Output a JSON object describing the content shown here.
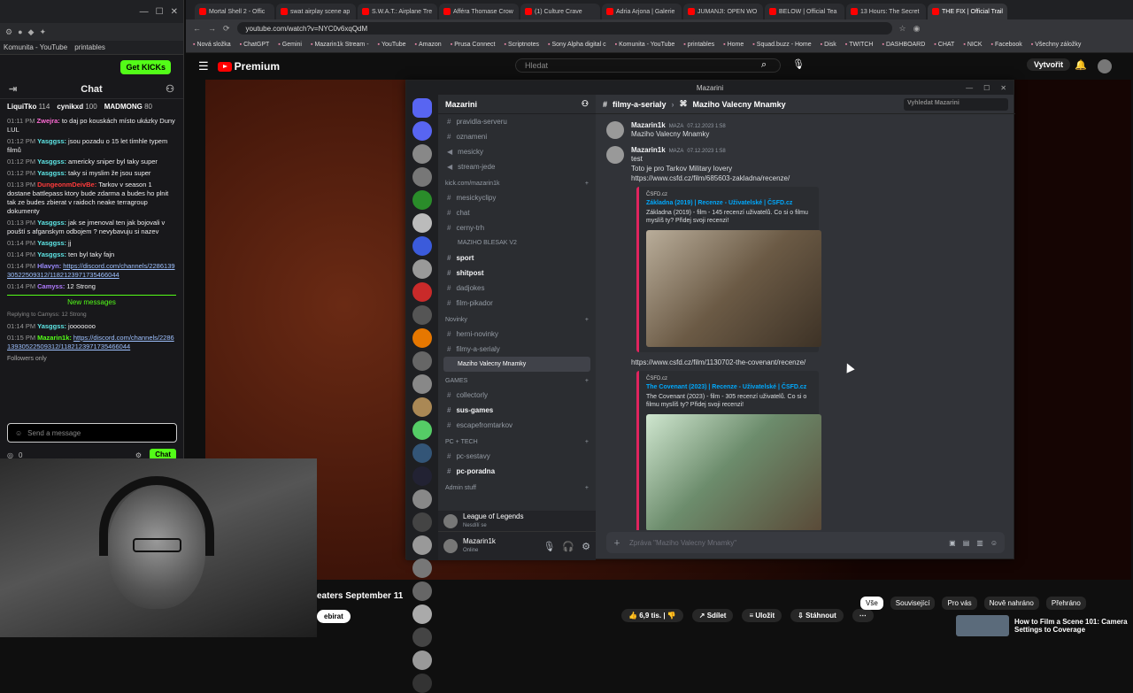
{
  "chat": {
    "get_kicks": "Get KICKs",
    "title": "Chat",
    "leaders": [
      {
        "name": "LiquiTko",
        "pts": "114"
      },
      {
        "name": "cynikxd",
        "pts": "100"
      },
      {
        "name": "MADMONG",
        "pts": "80"
      }
    ],
    "messages": [
      {
        "time": "01:11 PM",
        "user": "Zwejra:",
        "text": "to daj po kouskách místo ukázky Duny LUL",
        "color": "#ff6bd5"
      },
      {
        "time": "01:12 PM",
        "user": "Yasggss:",
        "text": "jsou pozadu o 15 let tímhle typem filmů",
        "color": "#5ee6e6"
      },
      {
        "time": "01:12 PM",
        "user": "Yasggss:",
        "text": "americky sniper byl taky super",
        "color": "#5ee6e6"
      },
      {
        "time": "01:12 PM",
        "user": "Yasggss:",
        "text": "taky si myslim že jsou super",
        "color": "#5ee6e6"
      },
      {
        "time": "01:13 PM",
        "user": "DungeonmDeivBe:",
        "text": "Tarkov v season 1 dostane battlepass ktory bude zdarma a budes ho plnit tak ze budes zbierat v raidoch neake terragroup dokumenty",
        "color": "#ff3b3b"
      },
      {
        "time": "01:13 PM",
        "user": "Yasggss:",
        "text": "jak se jmenoval ten jak bojovali v pouští s afganskym odbojem ? nevybavuju si nazev",
        "color": "#5ee6e6"
      },
      {
        "time": "01:14 PM",
        "user": "Yasggss:",
        "text": "jj",
        "color": "#5ee6e6"
      },
      {
        "time": "01:14 PM",
        "user": "Yasggss:",
        "text": "ten byl taky fajn",
        "color": "#5ee6e6"
      },
      {
        "time": "01:14 PM",
        "user": "Hlavyn:",
        "text": "https://discord.com/channels/228613930522509312/1182123971735466044",
        "color": "#9b8bff"
      },
      {
        "time": "01:14 PM",
        "user": "Camyss:",
        "text": "12 Strong",
        "color": "#b07bff"
      }
    ],
    "new_messages": "New messages",
    "reply_note": "Replying to Camyss: 12 Strong",
    "messages2": [
      {
        "time": "01:14 PM",
        "user": "Yasggss:",
        "text": "jooooooo",
        "color": "#5ee6e6"
      },
      {
        "time": "01:15 PM",
        "user": "Mazarin1k:",
        "text": "https://discord.com/channels/228613930522509312/1182123971735466044",
        "color": "#53fc18"
      }
    ],
    "followers_only": "Followers only",
    "input_placeholder": "Send a message",
    "count": "0",
    "send_label": "Chat"
  },
  "browser": {
    "tabs": [
      "Mortal Shell 2 - Offic",
      "swat airplay scene ap",
      "S.W.A.T.: Airplane Tre",
      "Afféra Thomase Crow",
      "(1) Culture Crave",
      "Adria Arjona | Galerie",
      "JUMANJI: OPEN WO",
      "BELOW | Official Tea",
      "13 Hours: The Secret",
      "THE FIX | Official Trail"
    ],
    "url": "youtube.com/watch?v=NYC0v6xqQdM",
    "bookmarks": [
      "Nová složka",
      "ChatGPT",
      "Gemini",
      "Mazarin1k Stream -",
      "YouTube",
      "Amazon",
      "Prusa Connect",
      "Scriptnotes",
      "Sony Alpha digital c",
      "Komunita - YouTube",
      "printables",
      "Home",
      "Squad.buzz - Home",
      "Disk",
      "TWITCH",
      "DASHBOARD",
      "CHAT",
      "NICK",
      "Facebook",
      "Všechny záložky"
    ]
  },
  "youtube": {
    "logo": "Premium",
    "search_placeholder": "Hledat",
    "create": "Vytvořit",
    "video_title": "eaters September 11",
    "subscribe": "ebirat",
    "likes": "6,9 tis.",
    "share": "Sdílet",
    "save": "Uložit",
    "download": "Stáhnout",
    "chips": [
      "Vše",
      "Související",
      "Pro vás",
      "Nově nahráno",
      "Přehráno"
    ],
    "suggestion": "How to Film a Scene 101: Camera Settings to Coverage"
  },
  "discord": {
    "window_title": "Mazarini",
    "server": "Mazarini",
    "channels_top": [
      "pravidla-serveru",
      "oznameni",
      "mesicky",
      "stream-jede"
    ],
    "cat_kick": "kick.com/mazarin1k",
    "channels_kick": [
      "mesickyclipy",
      "chat",
      "cerny-trh"
    ],
    "voice_sub": "MAZIHO BLESAK V2",
    "channels_mid": [
      "sport",
      "shitpost",
      "dadjokes",
      "film-pikador"
    ],
    "cat_novinky": "Novinky",
    "channels_novinky": [
      "herni-novinky",
      "filmy-a-serialy"
    ],
    "thread_selected": "Maziho Valecny Mnamky",
    "cat_games": "GAMES",
    "channels_games": [
      "collectorly",
      "sus-games",
      "escapefromtarkov"
    ],
    "cat_pc": "PC + TECH",
    "channels_pc": [
      "pc-sestavy",
      "pc-poradna"
    ],
    "cat_admin": "Admin stuff",
    "voice_status": "League of Legends",
    "voice_sub2": "Nesdílí se",
    "user": "Mazarin1k",
    "user_status": "Online",
    "breadcrumb_channel": "filmy-a-serialy",
    "breadcrumb_thread": "Maziho Valecny Mnamky",
    "search_placeholder": "Vyhledat Mazarini",
    "msg1": {
      "name": "Mazarin1k",
      "tag": "MAZA",
      "time": "07.12.2023 1:58",
      "text": "Maziho Valecny Mnamky"
    },
    "msg2": {
      "name": "Mazarin1k",
      "tag": "MAZA",
      "time": "07.12.2023 1:58",
      "line1": "test",
      "line2": "Toto je pro Tarkov Military lovery",
      "link1": "https://www.csfd.cz/film/685603-zakladna/recenze/"
    },
    "embed1": {
      "provider": "ČSFD.cz",
      "title": "Základna (2019) | Recenze - Uživatelské | ČSFD.cz",
      "desc": "Základna (2019) - film - 145 recenzí uživatelů. Co si o filmu myslíš ty? Přidej svoji recenzi!"
    },
    "link2": "https://www.csfd.cz/film/1130702-the-covenant/recenze/",
    "embed2": {
      "provider": "ČSFD.cz",
      "title": "The Covenant (2023) | Recenze - Uživatelské | ČSFD.cz",
      "desc": "The Covenant (2023) - film - 305 recenzí uživatelů. Co si o filmu myslíš ty? Přidej svoji recenzi!"
    },
    "composer_placeholder": "Zpráva \"Maziho Valecny Mnamky\""
  }
}
